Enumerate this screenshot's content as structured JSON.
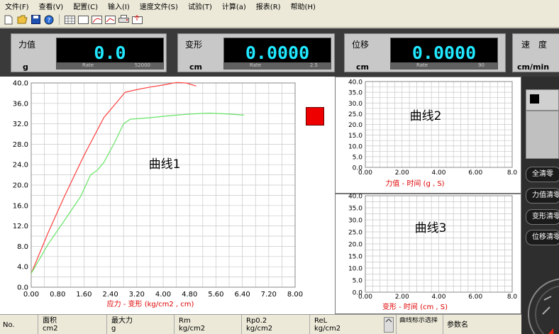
{
  "menu": [
    "文件(F)",
    "查看(V)",
    "配置(C)",
    "输入(I)",
    "速度文件(S)",
    "试验(T)",
    "计算(a)",
    "报表(R)",
    "帮助(H)"
  ],
  "toolbar": {
    "icons": [
      "new-file-icon",
      "open-folder-icon",
      "save-icon",
      "help-icon",
      "table-icon",
      "blank-sheet-icon",
      "curve-sheet-icon",
      "curve-sheet-2-icon",
      "print-icon",
      "export-icon"
    ]
  },
  "readouts": [
    {
      "label": "力值",
      "value": "0.0",
      "unit": "g",
      "rate_label": "Rate",
      "rate_value": "52000"
    },
    {
      "label": "变形",
      "value": "0.0000",
      "unit": "cm",
      "rate_label": "Rate",
      "rate_value": "2.5"
    },
    {
      "label": "位移",
      "value": "0.0000",
      "unit": "cm",
      "rate_label": "Rate",
      "rate_value": "90"
    },
    {
      "label": "速　度",
      "unit": "cm/min"
    }
  ],
  "chart_data": [
    {
      "type": "line",
      "title": "曲线1",
      "xlabel": "应力 - 变形  (kg/cm2 , cm)",
      "xlim": [
        0,
        8.0
      ],
      "ylim": [
        0,
        40.0
      ],
      "xticks": [
        "0.00",
        "0.80",
        "1.60",
        "2.40",
        "3.20",
        "4.00",
        "4.80",
        "5.60",
        "6.40",
        "7.20",
        "8.00"
      ],
      "yticks": [
        "40.0",
        "36.0",
        "32.0",
        "28.0",
        "24.0",
        "20.0",
        "16.0",
        "12.0",
        "8.0",
        "4.0",
        "0.0"
      ],
      "grid": true,
      "series": [
        {
          "color": "#ff4040",
          "x": [
            0.0,
            0.5,
            1.0,
            1.6,
            2.2,
            2.85,
            3.2,
            3.6,
            4.0,
            4.4,
            4.7,
            5.0
          ],
          "y": [
            2.7,
            10.5,
            17.7,
            25.8,
            33.2,
            38.2,
            38.7,
            39.2,
            39.6,
            40.1,
            40.0,
            39.4
          ]
        },
        {
          "color": "#66e466",
          "x": [
            0.0,
            0.5,
            1.0,
            1.5,
            1.8,
            2.0,
            2.2,
            2.5,
            2.8,
            3.0,
            3.6,
            4.2,
            4.8,
            5.4,
            6.0,
            6.45
          ],
          "y": [
            2.7,
            8.3,
            13.0,
            17.8,
            22.0,
            22.9,
            24.4,
            28.0,
            32.0,
            32.9,
            33.2,
            33.6,
            33.9,
            34.1,
            33.9,
            33.7
          ]
        }
      ]
    },
    {
      "type": "line",
      "title": "曲线2",
      "xlabel": "力值 - 时间   (g , S)",
      "xlim": [
        0,
        8.0
      ],
      "ylim": [
        0,
        40.0
      ],
      "xticks": [
        "0.00",
        "2.00",
        "4.00",
        "6.00",
        "8.0"
      ],
      "yticks": [
        "40.0",
        "35.0",
        "30.0",
        "25.0",
        "20.0",
        "15.0",
        "10.0",
        "5.0",
        "0.0"
      ],
      "grid": true,
      "series": []
    },
    {
      "type": "line",
      "title": "曲线3",
      "xlabel": "变形 - 时间   (cm , S)",
      "xlim": [
        0,
        8.0
      ],
      "ylim": [
        0,
        40.0
      ],
      "xticks": [
        "0.00",
        "2.00",
        "4.00",
        "6.00",
        "8.0"
      ],
      "yticks": [
        "40.0",
        "35.0",
        "30.0",
        "25.0",
        "20.0",
        "15.0",
        "10.0",
        "5.0",
        "0.0"
      ],
      "grid": true,
      "series": []
    }
  ],
  "right_panel": {
    "buttons": [
      "全清零",
      "力值清零",
      "变形清零",
      "位移清零"
    ]
  },
  "bottom_table": {
    "no": "No.",
    "columns": [
      {
        "name": "面积",
        "unit": "cm2"
      },
      {
        "name": "最大力",
        "unit": "g"
      },
      {
        "name": "Rm",
        "unit": "kg/cm2"
      },
      {
        "name": "Rp0.2",
        "unit": "kg/cm2"
      },
      {
        "name": "ReL",
        "unit": "kg/cm2"
      }
    ],
    "curve_label": "曲线标示选择",
    "param_label": "参数名"
  },
  "colors": {
    "indicator": "#ee0000",
    "readout_text": "#21e8ff",
    "axis_label": "#e00000"
  }
}
